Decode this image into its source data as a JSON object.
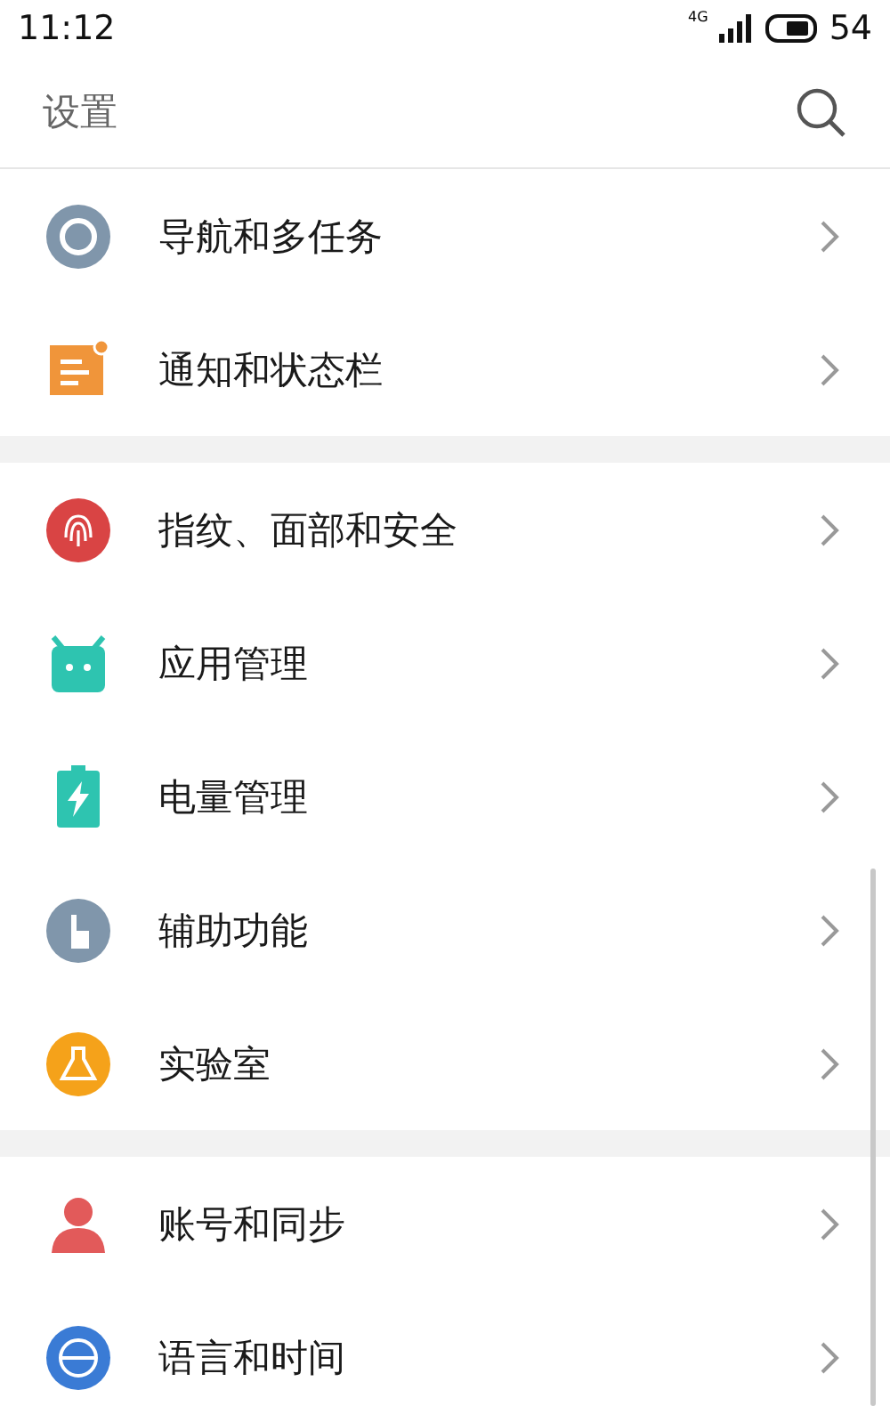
{
  "status_bar": {
    "time": "11:12",
    "network": "4G",
    "battery": "54"
  },
  "header": {
    "title": "设置"
  },
  "sections": [
    {
      "items": [
        {
          "label": "导航和多任务"
        },
        {
          "label": "通知和状态栏"
        }
      ]
    },
    {
      "items": [
        {
          "label": "指纹、面部和安全"
        },
        {
          "label": "应用管理"
        },
        {
          "label": "电量管理"
        },
        {
          "label": "辅助功能"
        },
        {
          "label": "实验室"
        }
      ]
    },
    {
      "items": [
        {
          "label": "账号和同步"
        },
        {
          "label": "语言和时间"
        }
      ]
    }
  ]
}
